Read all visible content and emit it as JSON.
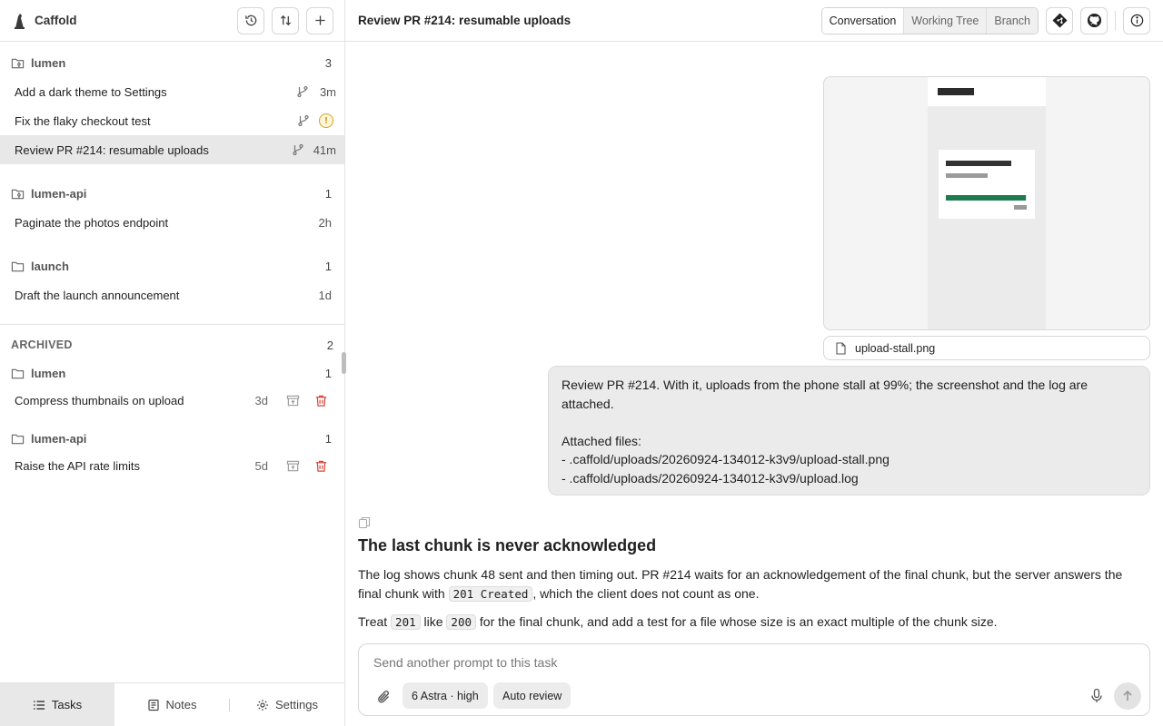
{
  "app": {
    "name": "Caffold"
  },
  "sidebar": {
    "groups": [
      {
        "name": "lumen",
        "count": "3",
        "tasks": [
          {
            "title": "Add a dark theme to Settings",
            "age": "3m",
            "status": "branch"
          },
          {
            "title": "Fix the flaky checkout test",
            "age": "",
            "status": "warning"
          },
          {
            "title": "Review PR #214: resumable uploads",
            "age": "41m",
            "status": "selected"
          }
        ]
      },
      {
        "name": "lumen-api",
        "count": "1",
        "tasks": [
          {
            "title": "Paginate the photos endpoint",
            "age": "2h"
          }
        ]
      },
      {
        "name": "launch",
        "count": "1",
        "tasks": [
          {
            "title": "Draft the launch announcement",
            "age": "1d"
          }
        ]
      }
    ],
    "archived": {
      "label": "ARCHIVED",
      "count": "2",
      "groups": [
        {
          "name": "lumen",
          "count": "1",
          "tasks": [
            {
              "title": "Compress thumbnails on upload",
              "age": "3d"
            }
          ]
        },
        {
          "name": "lumen-api",
          "count": "1",
          "tasks": [
            {
              "title": "Raise the API rate limits",
              "age": "5d"
            }
          ]
        }
      ]
    },
    "footer": {
      "tasks": "Tasks",
      "notes": "Notes",
      "settings": "Settings"
    }
  },
  "main": {
    "title": "Review PR #214: resumable uploads",
    "view_tabs": [
      "Conversation",
      "Working Tree",
      "Branch"
    ],
    "active_view": "Conversation"
  },
  "conversation": {
    "attachment": {
      "filename": "upload-stall.png",
      "preview_progress": 0.99
    },
    "user_message": {
      "line1": "Review PR #214. With it, uploads from the phone stall at 99%; the screenshot and the log are attached.",
      "files_label": "Attached files:",
      "file1": "- .caffold/uploads/20260924-134012-k3v9/upload-stall.png",
      "file2": "- .caffold/uploads/20260924-134012-k3v9/upload.log"
    },
    "reply": {
      "heading": "The last chunk is never acknowledged",
      "p1a": "The log shows chunk 48 sent and then timing out. PR #214 waits for an acknowledgement of the final chunk, but the server answers the final chunk with ",
      "p1code": "201 Created",
      "p1b": ", which the client does not count as one.",
      "p2a": "Treat ",
      "p2code1": "201",
      "p2b": " like ",
      "p2code2": "200",
      "p2c": " for the final chunk, and add a test for a file whose size is an exact multiple of the chunk size."
    }
  },
  "composer": {
    "placeholder": "Send another prompt to this task",
    "model": "6 Astra",
    "effort": "· high",
    "review": "Auto review"
  },
  "colors": {
    "warning": "#d6a31c",
    "delete": "#d9443a",
    "progress": "#1f7a4f",
    "selected_row": "#e8e8e8"
  }
}
